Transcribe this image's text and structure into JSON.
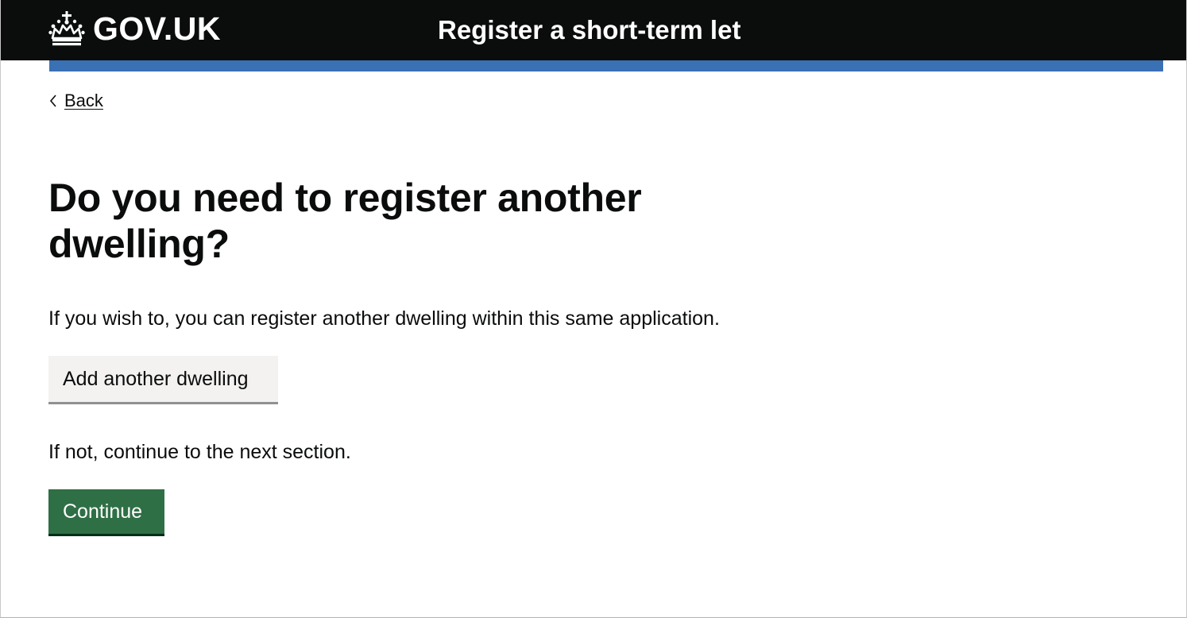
{
  "header": {
    "logo_text": "GOV.UK",
    "service_name": "Register a short-term let"
  },
  "navigation": {
    "back_label": "Back"
  },
  "main": {
    "heading": "Do you need to register another dwelling?",
    "intro_text": "If you wish to, you can register another dwelling within this same application.",
    "add_button_label": "Add another dwelling",
    "continue_text": "If not, continue to the next section.",
    "continue_button_label": "Continue"
  },
  "icons": {
    "logo": "crown-icon",
    "back": "chevron-left-icon"
  },
  "colors": {
    "header_background": "#0b0c0c",
    "header_accent_bar": "#3a70b4",
    "primary_button": "#2f6f45",
    "secondary_button": "#f3f2f1",
    "text": "#0b0c0c"
  }
}
